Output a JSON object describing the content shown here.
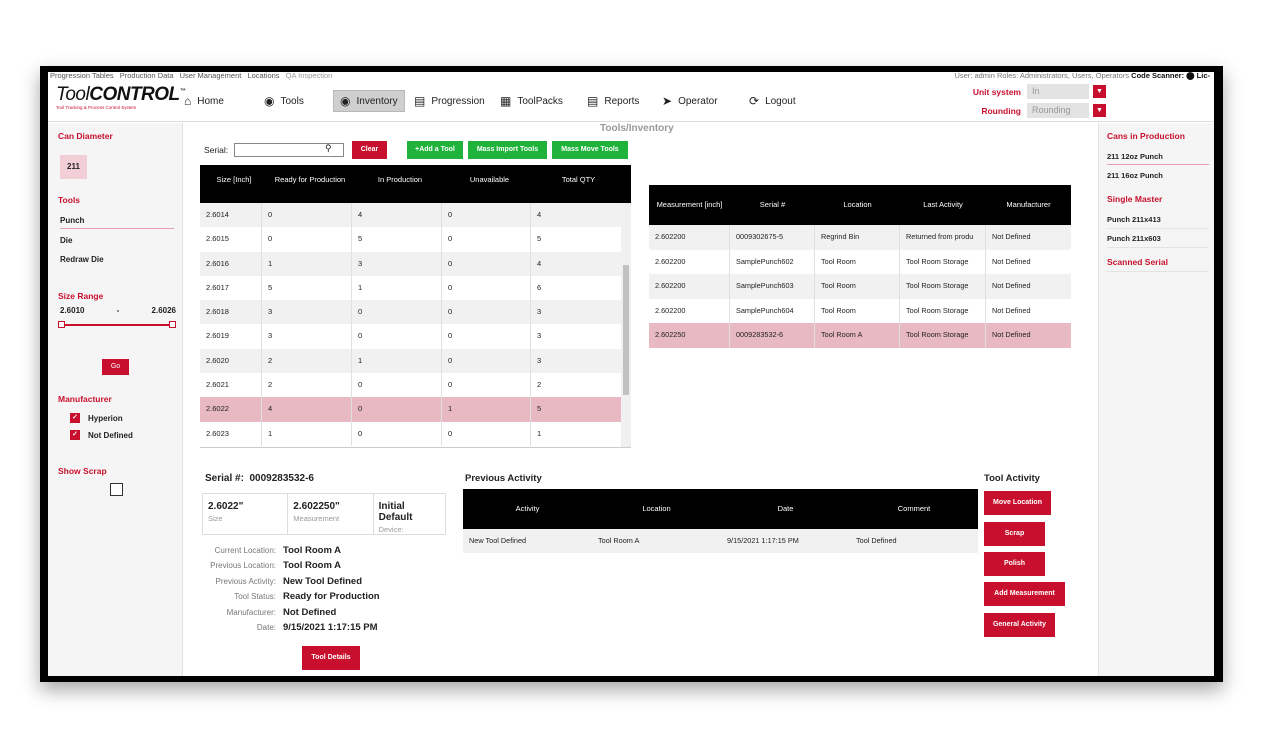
{
  "topbar": {
    "menu": [
      "Progression Tables",
      "Production Data",
      "User Management",
      "Locations",
      "QA Inspection"
    ],
    "user_text": "User: admin  Roles: Administrators, Users, Operators",
    "scanner_text": "Code Scanner: ⬤ Lic-"
  },
  "logo": {
    "tool": "Tool",
    "control": "CONTROL",
    "tm": "™",
    "tagline": "Tool Tracking & Process Control System"
  },
  "nav": {
    "home": "Home",
    "tools": "Tools",
    "inventory": "Inventory",
    "progression": "Progression",
    "toolpacks": "ToolPacks",
    "reports": "Reports",
    "operator": "Operator",
    "logout": "Logout"
  },
  "units": {
    "unit_label": "Unit system",
    "unit_value": "In",
    "rounding_label": "Rounding",
    "rounding_value": "Rounding"
  },
  "left": {
    "can_title": "Can Diameter",
    "can_value": "211",
    "tools_title": "Tools",
    "tools": [
      "Punch",
      "Die",
      "Redraw Die"
    ],
    "size_title": "Size Range",
    "size_min": "2.6010",
    "size_sep": "-",
    "size_max": "2.6026",
    "go": "Go",
    "manuf_title": "Manufacturer",
    "manufacturers": [
      "Hyperion",
      "Not Defined"
    ],
    "scrap_title": "Show Scrap"
  },
  "main": {
    "title": "Tools/Inventory",
    "serial_label": "Serial:",
    "serial_value": "",
    "clear": "Clear",
    "add_tool": "+Add a Tool",
    "mass_import": "Mass Import Tools",
    "mass_move": "Mass Move Tools"
  },
  "size_table": {
    "headers": [
      "Size [Inch]",
      "Ready for Production",
      "In Production",
      "Unavailable",
      "Total QTY"
    ],
    "rows": [
      [
        "2.6014",
        "0",
        "4",
        "0",
        "4"
      ],
      [
        "2.6015",
        "0",
        "5",
        "0",
        "5"
      ],
      [
        "2.6016",
        "1",
        "3",
        "0",
        "4"
      ],
      [
        "2.6017",
        "5",
        "1",
        "0",
        "6"
      ],
      [
        "2.6018",
        "3",
        "0",
        "0",
        "3"
      ],
      [
        "2.6019",
        "3",
        "0",
        "0",
        "3"
      ],
      [
        "2.6020",
        "2",
        "1",
        "0",
        "3"
      ],
      [
        "2.6021",
        "2",
        "0",
        "0",
        "2"
      ],
      [
        "2.6022",
        "4",
        "0",
        "1",
        "5"
      ],
      [
        "2.6023",
        "1",
        "0",
        "0",
        "1"
      ]
    ]
  },
  "meas_table": {
    "headers": [
      "Measurement [inch]",
      "Serial #",
      "Location",
      "Last Activity",
      "Manufacturer"
    ],
    "rows": [
      [
        "2.602200",
        "0009302675-5",
        "Regrind Bin",
        "Returned from produ",
        "Not Defined"
      ],
      [
        "2.602200",
        "SamplePunch602",
        "Tool Room",
        "Tool Room Storage",
        "Not Defined"
      ],
      [
        "2.602200",
        "SamplePunch603",
        "Tool Room",
        "Tool Room Storage",
        "Not Defined"
      ],
      [
        "2.602200",
        "SamplePunch604",
        "Tool Room",
        "Tool Room Storage",
        "Not Defined"
      ],
      [
        "2.602250",
        "0009283532-6",
        "Tool Room A",
        "Tool Room Storage",
        "Not Defined"
      ]
    ]
  },
  "detail": {
    "serial_label": "Serial #:",
    "serial": "0009283532-6",
    "size": "2.6022\"",
    "size_lbl": "Size",
    "measurement": "2.602250\"",
    "measurement_lbl": "Measurement",
    "device": "Initial Default",
    "device_lbl": "Device:",
    "current_location_k": "Current Location:",
    "current_location": "Tool Room A",
    "previous_location_k": "Previous Location:",
    "previous_location": "Tool Room A",
    "previous_activity_k": "Previous Activity:",
    "previous_activity": "New Tool Defined",
    "tool_status_k": "Tool Status:",
    "tool_status": "Ready for Production",
    "manufacturer_k": "Manufacturer:",
    "manufacturer": "Not Defined",
    "date_k": "Date:",
    "date": "9/15/2021 1:17:15 PM",
    "tool_details": "Tool Details"
  },
  "activity": {
    "title": "Previous Activity",
    "headers": [
      "Activity",
      "Location",
      "Date",
      "Comment"
    ],
    "row": [
      "New Tool Defined",
      "Tool Room A",
      "9/15/2021 1:17:15 PM",
      "Tool Defined"
    ]
  },
  "tool_activity": {
    "title": "Tool Activity",
    "buttons": [
      "Move Location",
      "Scrap",
      "Polish",
      "Add Measurement",
      "General Activity"
    ]
  },
  "right": {
    "cans_title": "Cans in Production",
    "cans": [
      "211 12oz Punch",
      "211 16oz Punch"
    ],
    "single_title": "Single Master",
    "single": [
      "Punch 211x413",
      "Punch 211x603"
    ],
    "scanned_title": "Scanned Serial"
  }
}
